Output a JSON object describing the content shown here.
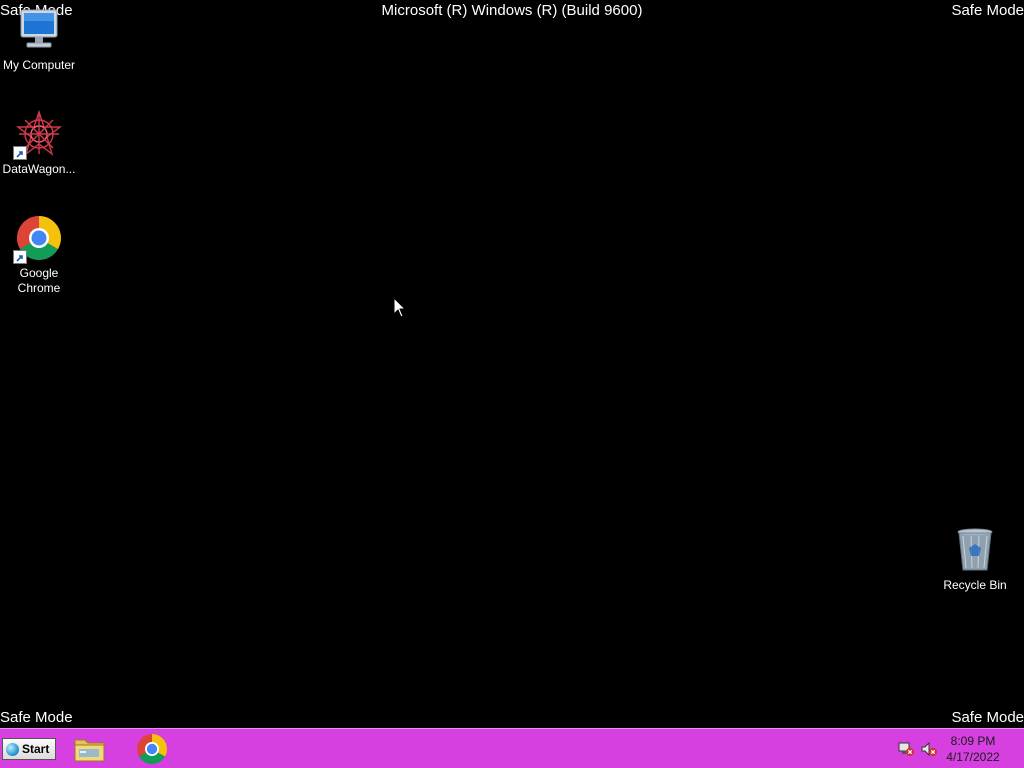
{
  "screen": {
    "title": "Microsoft (R) Windows (R) (Build 9600)",
    "safe_mode_label": "Safe Mode"
  },
  "desktop_icons": [
    {
      "label": "My Computer",
      "icon": "computer-icon"
    },
    {
      "label": "DataWagon...",
      "icon": "datawagon-icon",
      "shortcut": true
    },
    {
      "label": "Google Chrome",
      "icon": "chrome-icon",
      "shortcut": true
    },
    {
      "label": "Recycle Bin",
      "icon": "recycle-bin-icon"
    }
  ],
  "taskbar": {
    "color": "#d63fe0",
    "start_label": "Start",
    "pinned": [
      {
        "name": "File Explorer",
        "icon": "folder-icon"
      },
      {
        "name": "Google Chrome",
        "icon": "chrome-icon"
      }
    ],
    "tray": {
      "icons": [
        "network-error-icon",
        "volume-muted-icon"
      ],
      "time": "8:09 PM",
      "date": "4/17/2022"
    }
  }
}
